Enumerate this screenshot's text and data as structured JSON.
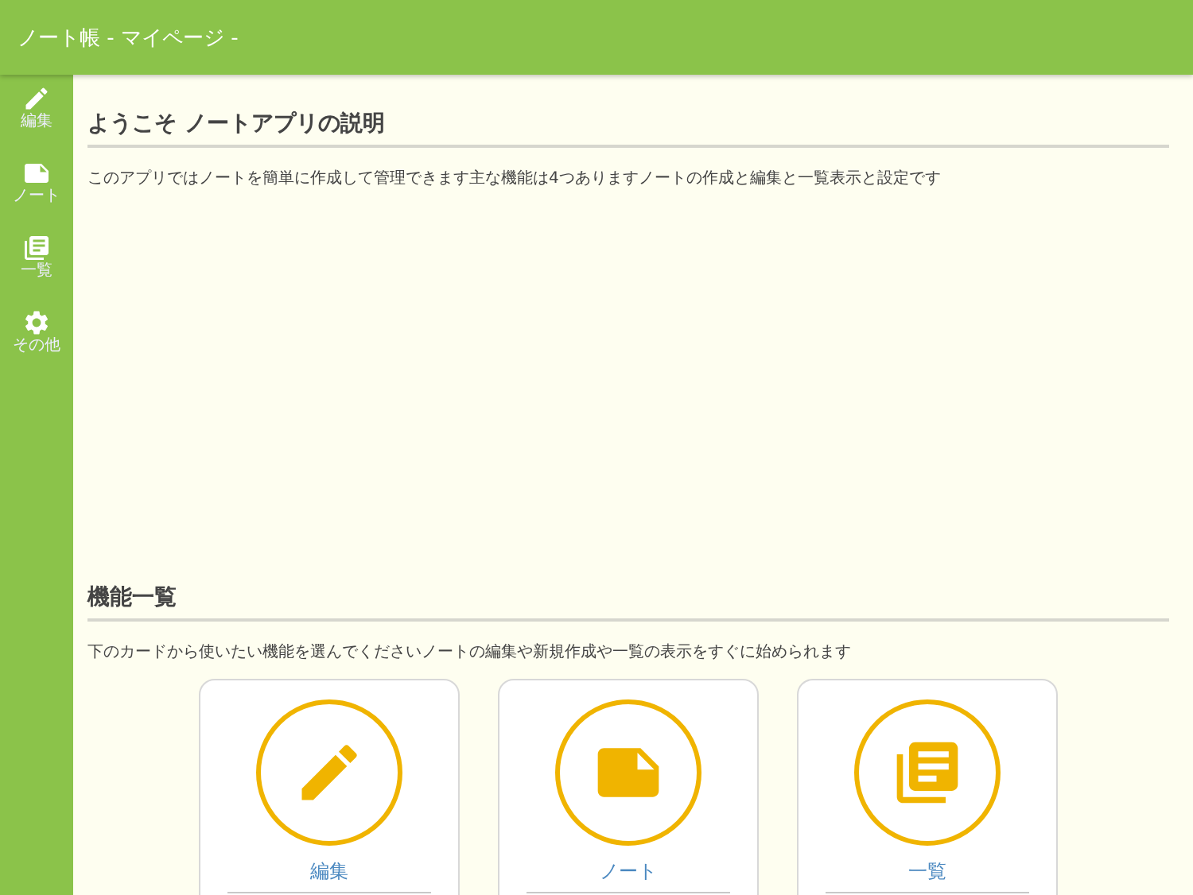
{
  "header": {
    "title": "ノート帳 - マイページ -"
  },
  "sidebar": {
    "items": [
      {
        "label": "編集",
        "kind": "edit"
      },
      {
        "label": "ノート",
        "kind": "note"
      },
      {
        "label": "一覧",
        "kind": "list"
      },
      {
        "label": "その他",
        "kind": "settings"
      }
    ]
  },
  "sections": [
    {
      "title": "ようこそ ノートアプリの説明",
      "text": "このアプリではノートを簡単に作成して管理できます主な機能は4つありますノートの作成と編集と一覧表示と設定です"
    },
    {
      "title": "機能一覧",
      "text": "下のカードから使いたい機能を選んでくださいノートの編集や新規作成や一覧の表示をすぐに始められます"
    }
  ],
  "cards": [
    {
      "label": "編集",
      "kind": "edit"
    },
    {
      "label": "ノート",
      "kind": "note"
    },
    {
      "label": "一覧",
      "kind": "list"
    }
  ]
}
